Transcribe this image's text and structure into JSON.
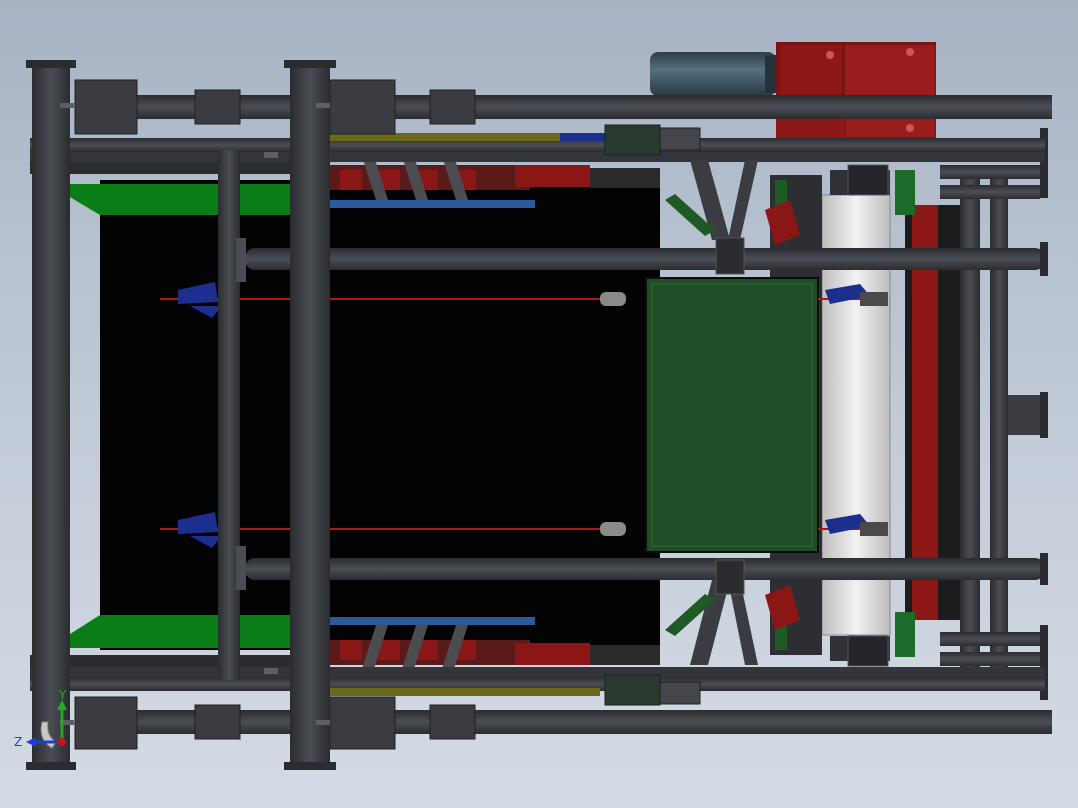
{
  "viewport": {
    "title": "",
    "triad": {
      "y_label": "Y",
      "z_label": "Z",
      "y_color": "#22aa22",
      "z_color": "#1d3fd8",
      "x_color": "#cc1111"
    }
  },
  "colors": {
    "steel": "#3c3e44",
    "steel_dark": "#26282c",
    "steel_light": "#55585f",
    "belt": "#030303",
    "frame_green": "#1f4e26",
    "belt_edge_green": "#0a7d16",
    "idler_red": "#8a1616",
    "motor_blue": "#3a4e5a",
    "gearbox_red": "#8c1717",
    "pulley_grey": "#dcdcdc",
    "cable_red": "#b01818",
    "accent_blue": "#2a5a9a",
    "accent_navy": "#1c2f8f",
    "accent_yellow": "#6a6a1a"
  }
}
